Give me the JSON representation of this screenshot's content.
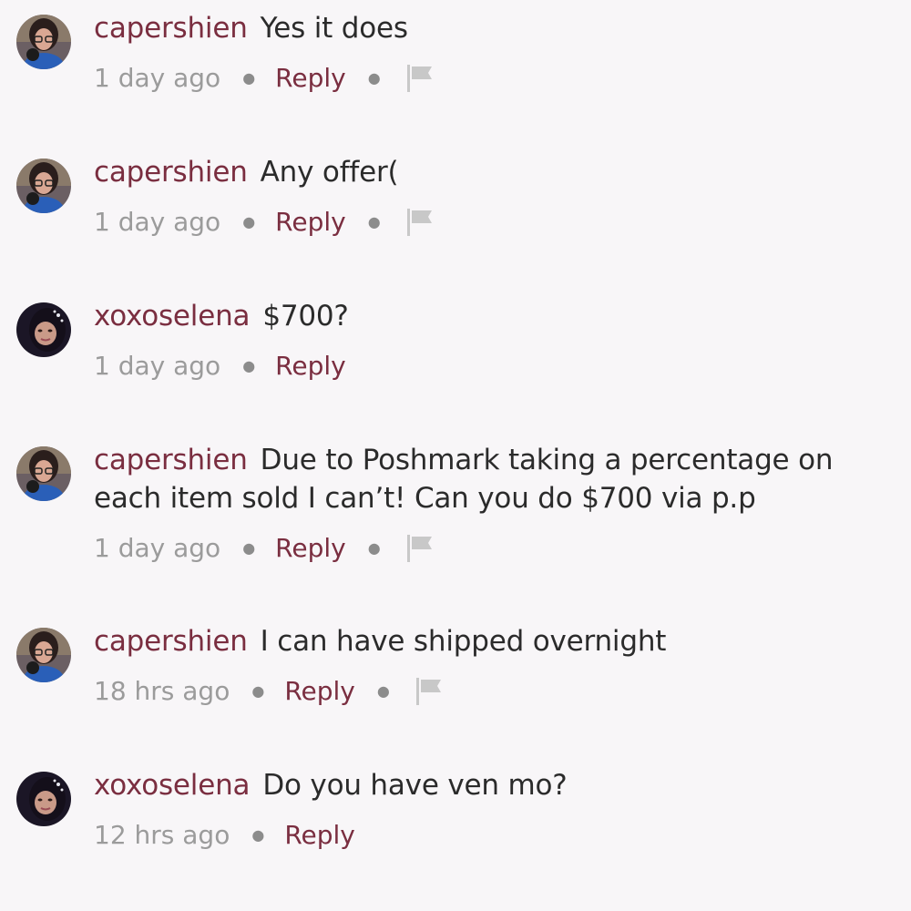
{
  "comments": [
    {
      "username": "capershien",
      "text": "Yes it does",
      "time": "1 day ago",
      "reply_label": "Reply",
      "flag_icon": "flag-icon",
      "avatar": "capershien"
    },
    {
      "username": "capershien",
      "text": "Any offer(",
      "time": "1 day ago",
      "reply_label": "Reply",
      "flag_icon": "flag-icon",
      "avatar": "capershien"
    },
    {
      "username": "xoxoselena",
      "text": "$700?",
      "time": "1 day ago",
      "reply_label": "Reply",
      "avatar": "xoxoselena"
    },
    {
      "username": "capershien",
      "text": "Due to Poshmark taking a percentage on each item sold I can’t! Can you do $700 via p.p",
      "time": "1 day ago",
      "reply_label": "Reply",
      "flag_icon": "flag-icon",
      "avatar": "capershien"
    },
    {
      "username": "capershien",
      "text": "I can have shipped overnight",
      "time": "18 hrs ago",
      "reply_label": "Reply",
      "flag_icon": "flag-icon",
      "avatar": "capershien"
    },
    {
      "username": "xoxoselena",
      "text": "Do you have ven mo?",
      "time": "12 hrs ago",
      "reply_label": "Reply",
      "avatar": "xoxoselena"
    }
  ],
  "colors": {
    "background": "#f8f6f8",
    "username": "#7a2e40",
    "reply": "#7a2e40",
    "body_text": "#2b2b2b",
    "timestamp": "#9b9b9b",
    "flag": "#c8c8c8"
  }
}
